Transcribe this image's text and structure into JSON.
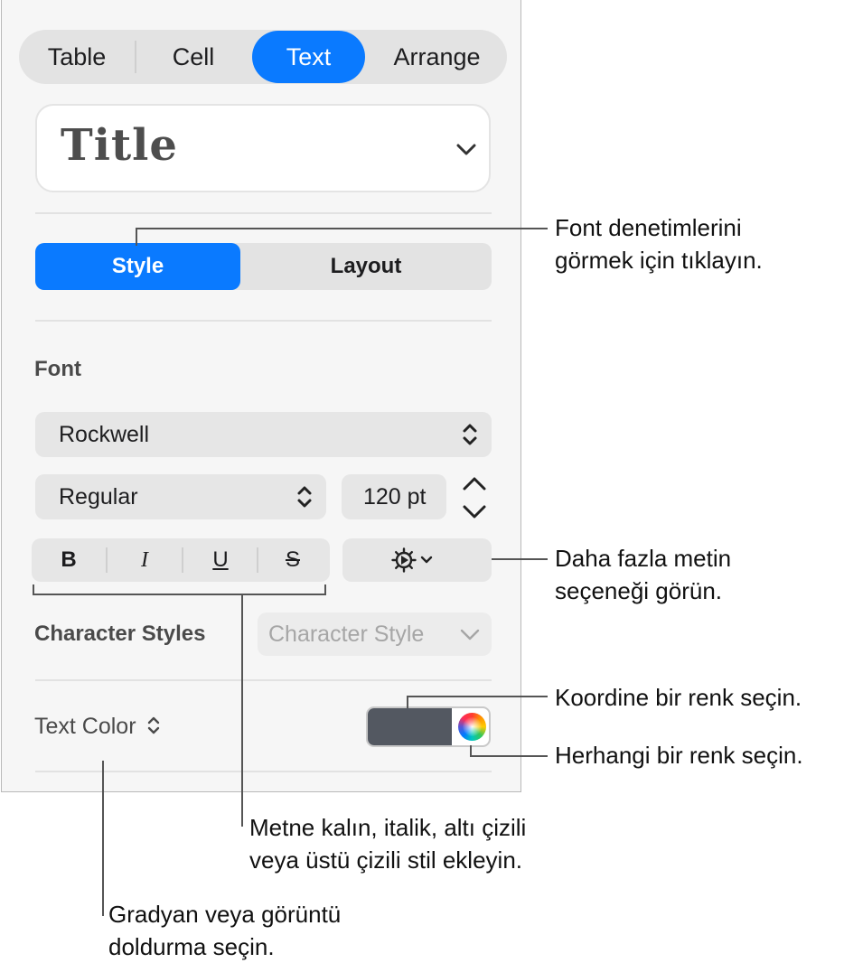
{
  "tabs": [
    {
      "label": "Table",
      "active": false
    },
    {
      "label": "Cell",
      "active": false
    },
    {
      "label": "Text",
      "active": true
    },
    {
      "label": "Arrange",
      "active": false
    }
  ],
  "paragraph_style": {
    "value": "Title",
    "chevron_icon": "chevron-down-icon"
  },
  "segmented": {
    "style": "Style",
    "layout": "Layout",
    "selected": "Style"
  },
  "font": {
    "heading": "Font",
    "family": "Rockwell",
    "typeface": "Regular",
    "size": "120 pt"
  },
  "format_buttons": {
    "bold": "B",
    "italic": "I",
    "underline": "U",
    "strikethrough": "S"
  },
  "more_options_icon": "gear-chevron-icon",
  "character_styles": {
    "label": "Character Styles",
    "placeholder": "Character Style"
  },
  "text_color": {
    "label": "Text Color",
    "swatch_color": "#535861"
  },
  "accent_color": "#0a7aff",
  "callouts": {
    "style_tab": [
      "Font denetimlerini",
      "görmek için tıklayın."
    ],
    "more_options": [
      "Daha fazla metin",
      "seçeneği görün."
    ],
    "color_well": "Koordine bir renk seçin.",
    "color_wheel": "Herhangi bir renk seçin.",
    "format": [
      "Metne kalın, italik, altı çizili",
      "veya üstü çizili stil ekleyin."
    ],
    "text_color": [
      "Gradyan veya görüntü",
      "doldurma seçin."
    ]
  }
}
